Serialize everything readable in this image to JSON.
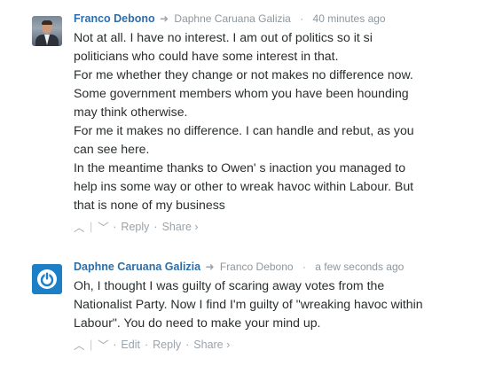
{
  "comments": [
    {
      "author": "Franco Debono",
      "reply_to": "Daphne Caruana Galizia",
      "time": "40 minutes ago",
      "lines": [
        "Not at all. I have no interest. I am out of politics so it si",
        "politicians who could have some interest in that.",
        "For me whether they change or not makes no difference now.",
        "Some government members whom you have been hounding",
        "may think otherwise.",
        "For me it makes no difference. I can handle and rebut, as you",
        "can see here.",
        "In the meantime thanks to Owen' s inaction you managed to",
        "help ins some way or other to wreak havoc within Labour. But",
        "that is none of my business"
      ],
      "actions": {
        "reply": "Reply",
        "share": "Share ›"
      }
    },
    {
      "author": "Daphne Caruana Galizia",
      "reply_to": "Franco Debono",
      "time": "a few seconds ago",
      "lines": [
        "Oh, I thought I was guilty of scaring away votes from the",
        "Nationalist Party. Now I find I'm guilty of \"wreaking havoc within",
        "Labour\". You do need to make your mind up."
      ],
      "actions": {
        "edit": "Edit",
        "reply": "Reply",
        "share": "Share ›"
      }
    }
  ],
  "icons": {
    "arrow": "➜",
    "bullet": "·",
    "upvote": "︿",
    "downvote": "﹀"
  }
}
